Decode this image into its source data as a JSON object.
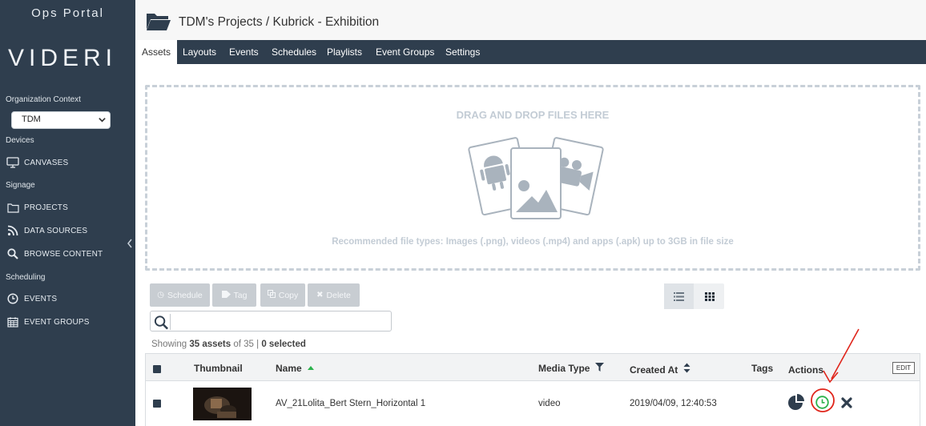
{
  "sidebar": {
    "portal_title": "Ops Portal",
    "logo": "VIDERI",
    "org_context_label": "Organization Context",
    "org_selected": "TDM",
    "devices_label": "Devices",
    "signage_label": "Signage",
    "scheduling_label": "Scheduling",
    "items": [
      {
        "label": "CANVASES",
        "icon": "monitor-icon"
      },
      {
        "label": "PROJECTS",
        "icon": "folder-icon"
      },
      {
        "label": "DATA SOURCES",
        "icon": "rss-icon"
      },
      {
        "label": "BROWSE CONTENT",
        "icon": "search-icon"
      },
      {
        "label": "EVENTS",
        "icon": "clock-icon"
      },
      {
        "label": "EVENT GROUPS",
        "icon": "calendar-icon"
      }
    ]
  },
  "header": {
    "title": "TDM's Projects / Kubrick - Exhibition"
  },
  "tabs": [
    {
      "label": "Assets",
      "active": true
    },
    {
      "label": "Layouts"
    },
    {
      "label": "Events"
    },
    {
      "label": "Schedules"
    },
    {
      "label": "Playlists"
    },
    {
      "label": "Event Groups"
    },
    {
      "label": "Settings"
    }
  ],
  "dropzone": {
    "title": "DRAG AND DROP FILES HERE",
    "hint": "Recommended file types: Images (.png), videos (.mp4) and apps (.apk) up to 3GB in file size"
  },
  "toolbar": {
    "schedule_label": "Schedule",
    "tag_label": "Tag",
    "copy_label": "Copy",
    "delete_label": "Delete"
  },
  "search": {
    "value": "",
    "placeholder": ""
  },
  "summary": {
    "prefix": "Showing",
    "assets_count": "35 assets",
    "of_total": "of 35",
    "separator": "|",
    "selected": "0 selected"
  },
  "table": {
    "headers": {
      "thumbnail": "Thumbnail",
      "name": "Name",
      "media_type": "Media Type",
      "created_at": "Created At",
      "tags": "Tags",
      "actions": "Actions",
      "edit": "EDIT"
    },
    "rows": [
      {
        "name": "AV_21Lolita_Bert Stern_Horizontal 1",
        "media_type": "video",
        "created_at": "2019/04/09, 12:40:53",
        "tags": ""
      }
    ]
  },
  "colors": {
    "sidebar_bg": "#2f3e4e",
    "annotation_red": "#e0251b",
    "schedule_green": "#2bb24c"
  }
}
